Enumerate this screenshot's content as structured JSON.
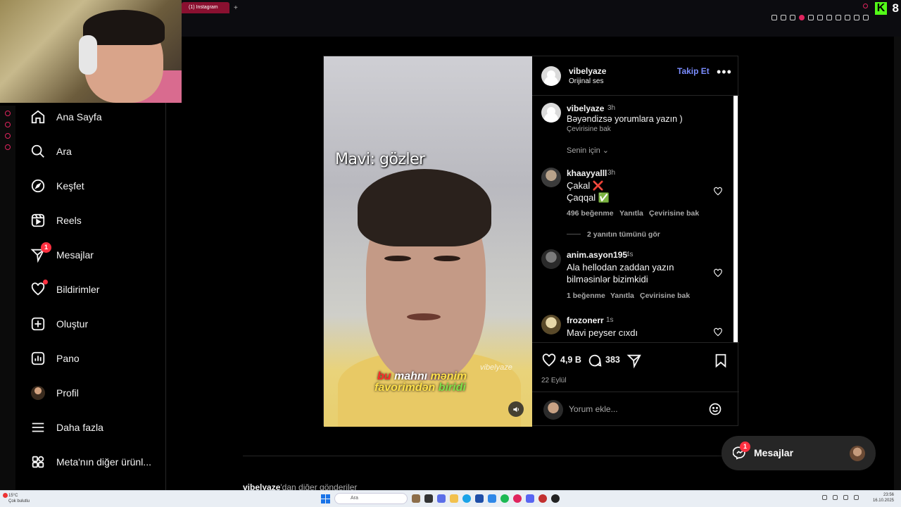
{
  "browser": {
    "tab_title": "(1) Instagram",
    "new_tab": "+",
    "kick_letter": "K",
    "kick_count": "8"
  },
  "sidebar": {
    "items": [
      {
        "label": "Ana Sayfa",
        "icon": "home-icon"
      },
      {
        "label": "Ara",
        "icon": "search-icon"
      },
      {
        "label": "Keşfet",
        "icon": "compass-icon"
      },
      {
        "label": "Reels",
        "icon": "reels-icon"
      },
      {
        "label": "Mesajlar",
        "icon": "direct-icon",
        "badge": "1"
      },
      {
        "label": "Bildirimler",
        "icon": "heart-icon"
      },
      {
        "label": "Oluştur",
        "icon": "create-icon"
      },
      {
        "label": "Pano",
        "icon": "dashboard-icon"
      },
      {
        "label": "Profil",
        "icon": "profile-avatar"
      },
      {
        "label": "Daha fazla",
        "icon": "menu-icon"
      },
      {
        "label": "Meta'nın diğer ürünl...",
        "icon": "meta-apps-icon"
      }
    ]
  },
  "video": {
    "caption_top": "Mavi: gözler",
    "caption_line1": [
      "bu",
      " mahnı",
      " mənim"
    ],
    "caption_line2": [
      "favorimdən",
      " biridi"
    ],
    "watermark": "vibelyaze"
  },
  "post": {
    "author": "vibelyaze",
    "audio": "Orijinal ses",
    "follow_label": "Takip Et",
    "more": "•••",
    "caption": {
      "user": "vibelyaze",
      "time": "3h",
      "text": "Bəyəndizsə yorumlara yazın )",
      "translate": "Çevirisine bak"
    },
    "sort_label": "Senin için",
    "comments": [
      {
        "user": "khaayyalll",
        "time": "3h",
        "lines": [
          "Çakal ❌",
          "Çaqqal ✅"
        ],
        "likes": "496 beğenme",
        "reply": "Yanıtla",
        "translate": "Çevirisine bak",
        "replies": "2 yanıtın tümünü gör"
      },
      {
        "user": "anim.asyon195",
        "time": "4s",
        "lines": [
          "Ala hellodan zaddan yazın",
          "bilməsinlər bizimkidi"
        ],
        "likes": "1 beğenme",
        "reply": "Yanıtla",
        "translate": "Çevirisine bak"
      },
      {
        "user": "frozonerr",
        "time": "1s",
        "lines": [
          "Mavi peyser cıxdı"
        ]
      }
    ],
    "like_count": "4,9 B",
    "comment_count": "383",
    "date": "22 Eylül",
    "comment_placeholder": "Yorum ekle..."
  },
  "more_posts": {
    "user": "vibelyaze",
    "suffix": "'dan diğer gönderiler"
  },
  "messages_pill": {
    "label": "Mesajlar",
    "badge": "1"
  },
  "taskbar": {
    "weather_temp": "15°C",
    "weather_desc": "Çok bulutlu",
    "search_placeholder": "Ara",
    "time": "23:56",
    "date": "16.10.2025"
  }
}
